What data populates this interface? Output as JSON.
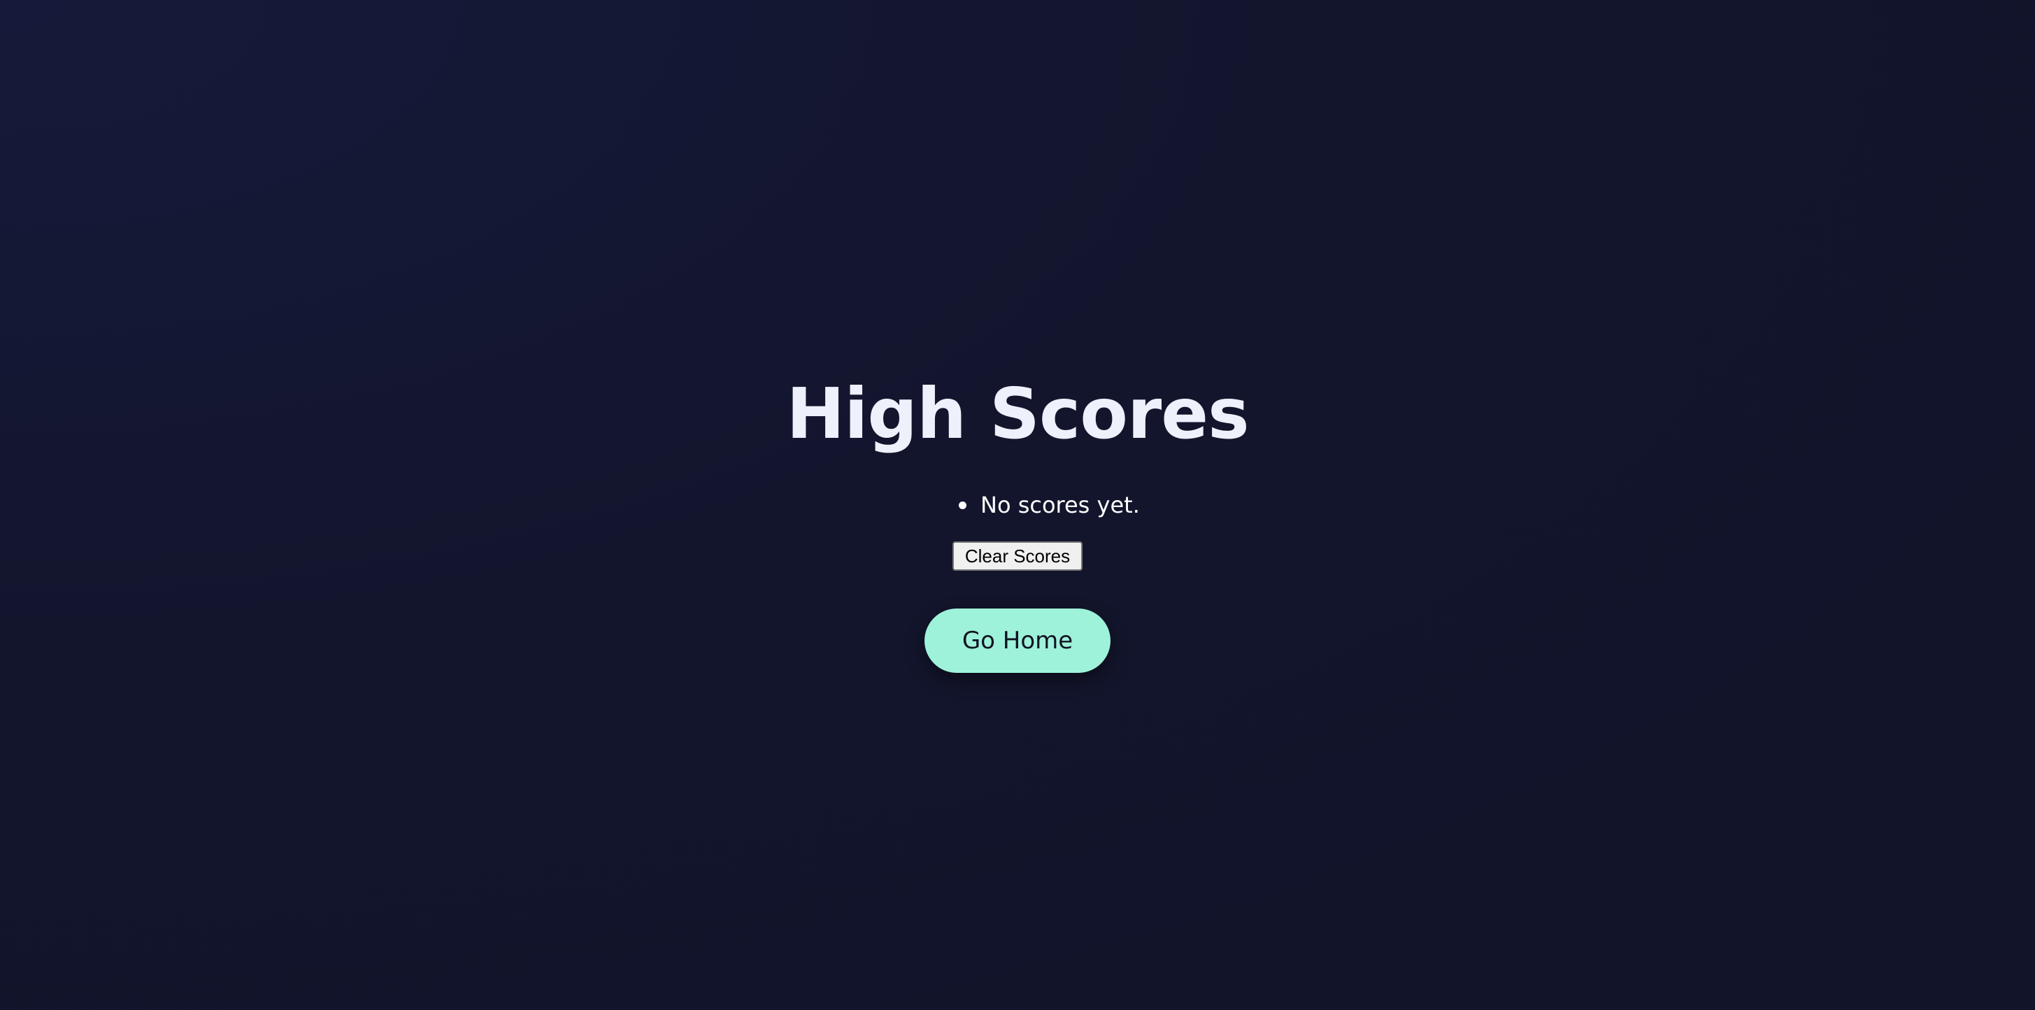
{
  "page": {
    "title": "High Scores",
    "background_color": "#131530"
  },
  "scores": {
    "items": [
      "No scores yet."
    ],
    "clear_label": "Clear Scores"
  },
  "navigation": {
    "home_label": "Go Home",
    "home_button_color": "#9ef2d9"
  }
}
